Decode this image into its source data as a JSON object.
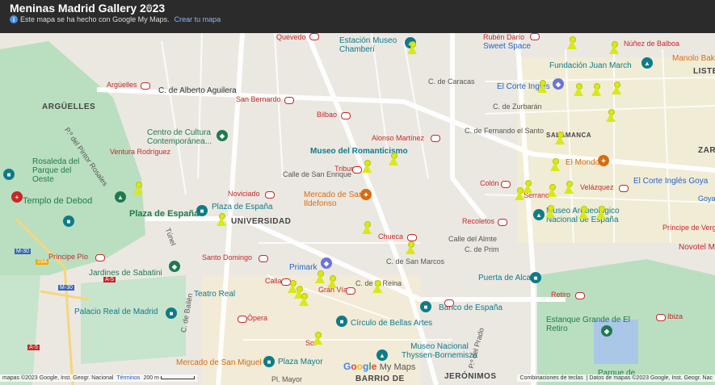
{
  "header": {
    "title": "Meninas Madrid Gallery 2023",
    "info_text": "Este mapa se ha hecho con Google My Maps.",
    "create_link": "Crear tu mapa"
  },
  "labels": {
    "quevedo": "Quevedo",
    "estacion": "Estación Museo Chamberí",
    "ruben_dario": "Rubén Darío",
    "nunez_balboa": "Núñez de Balboa",
    "sweet_space": "Sweet Space",
    "fundacion": "Fundación Juan March",
    "manolo": "Manolo Bakes",
    "arguelles_m": "Argüelles",
    "arguelles": "ARGÜELLES",
    "alberto_aguilera": "C. de Alberto Aguilera",
    "san_bernardo": "San Bernardo",
    "bilbao": "Bilbao",
    "el_corte": "El Corte Inglés",
    "caracas": "C. de Caracas",
    "zurbaran": "C. de Zurbarán",
    "fernando": "C. de Fernando el Santo",
    "centro_cultura": "Centro de Cultura Contemporánea...",
    "ventura": "Ventura Rodríguez",
    "rosaleda": "Rosaleda del Parque del Oeste",
    "alonso": "Alonso Martínez",
    "romanticismo": "Museo del Romanticismo",
    "tribunal": "Tribunal",
    "salamanca": "SALAMANCA",
    "el_mondo": "El Mondo",
    "el_corte_goya": "El Corte Inglés Goya",
    "templo": "Templo de Debod",
    "plaza_espana_park": "Plaza de España",
    "plaza_espana_m": "Plaza de España",
    "noviciado": "Noviciado",
    "universidad": "UNIVERSIDAD",
    "mercado": "Mercado de San Ildefonso",
    "colon": "Colón",
    "serrano": "Serrano",
    "velazquez": "Velázquez",
    "museo_arq": "Museo Arqueológico Nacional de España",
    "principe_pio": "Príncipe Pío",
    "santo_domingo": "Santo Domingo",
    "chueca": "Chueca",
    "recoletos": "Recoletos",
    "almte": "Calle del Almte",
    "prim": "C. de Prim",
    "san_marcos": "C. de San Marcos",
    "principe_vergara": "Príncipe de Vergara",
    "novotel": "Novotel M",
    "jardines": "Jardines de Sabatini",
    "callao": "Callao",
    "primark": "Primark",
    "gran_via": "Gran Vía",
    "de_la_reina": "C. de la Reina",
    "puerta_alcala": "Puerta de Alcalá",
    "retiro": "Retiro",
    "teatro_real": "Teatro Real",
    "banco": "Banco de España",
    "palacio": "Palacio Real de Madrid",
    "opera": "Ópera",
    "circulo": "Círculo de Bellas Artes",
    "estanque": "Estanque Grande de El Retiro",
    "ibiza": "Ibiza",
    "mercado_sm": "Mercado de San Miguel",
    "plaza_mayor": "Plaza Mayor",
    "sol": "Sol",
    "thyssen": "Museo Nacional Thyssen-Bornemisza",
    "barrio": "BARRIO DE",
    "jeronimos": "JERÓNIMOS",
    "parque_de": "Parque de",
    "liste": "LISTE",
    "zara": "ZARA",
    "goya_m": "Goya",
    "m30a": "M-30",
    "m30b": "M-30",
    "a5a": "A-5",
    "a5b": "A-5",
    "e19a": "19A",
    "bailen": "C. de Bailén",
    "prado": "P.º del Prado",
    "pintor_rosales": "P.º del Pintor Rosales",
    "san_enrique": "Calle de San Enrique",
    "tunel": "Túnel",
    "mayor": "Pl. Mayor"
  },
  "google": {
    "g": "G",
    "o1": "o",
    "o2": "o",
    "g2": "g",
    "l": "l",
    "e": "e",
    "mymaps": "My Maps"
  },
  "footer": {
    "left": "mapas ©2023 Google, Inst. Geogr. Nacional",
    "terms": "Términos",
    "scale": "200 m",
    "shortcuts": "Combinaciones de teclas",
    "data": "Datos de mapas ©2023 Google, Inst. Geogr. Nac"
  }
}
